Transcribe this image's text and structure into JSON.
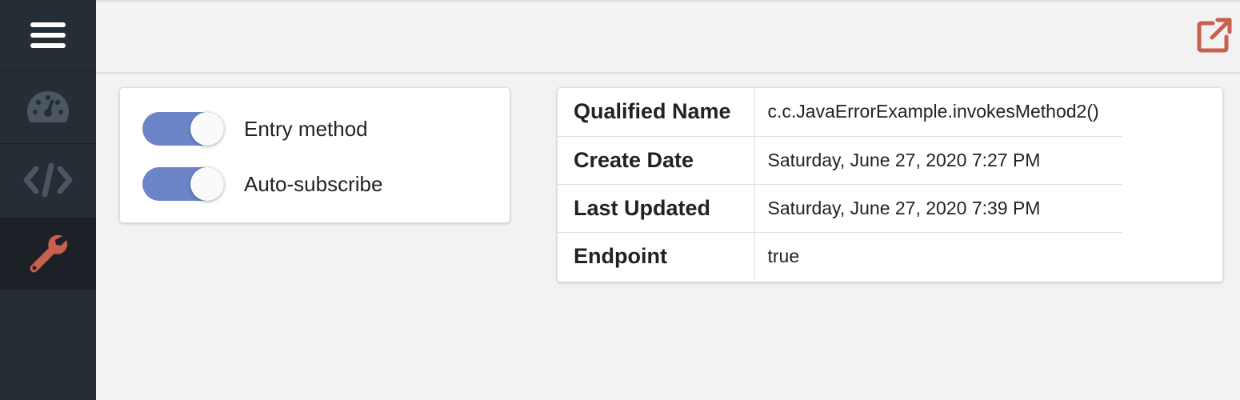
{
  "sidebar": {
    "items": [
      {
        "name": "menu",
        "icon": "hamburger-menu-icon"
      },
      {
        "name": "dashboard",
        "icon": "speedometer-icon"
      },
      {
        "name": "code",
        "icon": "code-icon"
      },
      {
        "name": "tools",
        "icon": "wrench-icon",
        "active": true
      }
    ]
  },
  "topbar": {
    "action_icon": "external-link-icon"
  },
  "toggles": [
    {
      "label": "Entry method",
      "on": true
    },
    {
      "label": "Auto-subscribe",
      "on": true
    }
  ],
  "details": {
    "rows": [
      {
        "key": "Qualified Name",
        "value": "c.c.JavaErrorExample.invokesMethod2()"
      },
      {
        "key": "Create Date",
        "value": "Saturday, June 27, 2020 7:27 PM"
      },
      {
        "key": "Last Updated",
        "value": "Saturday, June 27, 2020 7:39 PM"
      },
      {
        "key": "Endpoint",
        "value": "true"
      }
    ]
  },
  "colors": {
    "sidebar_bg": "#252d35",
    "sidebar_active_bg": "#1b2127",
    "icon_muted": "#4b5660",
    "accent_orange": "#c8604d",
    "toggle_on": "#6b85c8",
    "page_bg": "#f2f2f2"
  }
}
